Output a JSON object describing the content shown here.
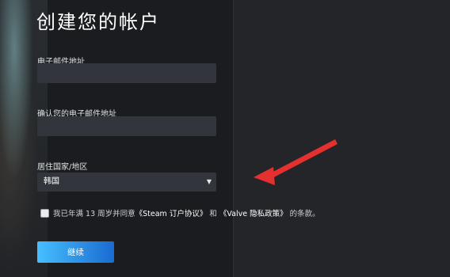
{
  "title": "创建您的帐户",
  "form": {
    "email_label": "电子邮件地址",
    "email_value": "",
    "confirm_label": "确认您的电子邮件地址",
    "confirm_value": "",
    "country_label": "居住国家/地区",
    "country_value": "韩国"
  },
  "agreement": {
    "prefix": "我已年满 13 周岁并同意",
    "link1": "《Steam 订户协议》",
    "middle": "和",
    "link2": "《Valve 隐私政策》",
    "suffix": "的条款。"
  },
  "continue_label": "继续",
  "colors": {
    "accent_start": "#47bfff",
    "accent_end": "#1a6bd1",
    "annotation_arrow": "#e4302e"
  }
}
